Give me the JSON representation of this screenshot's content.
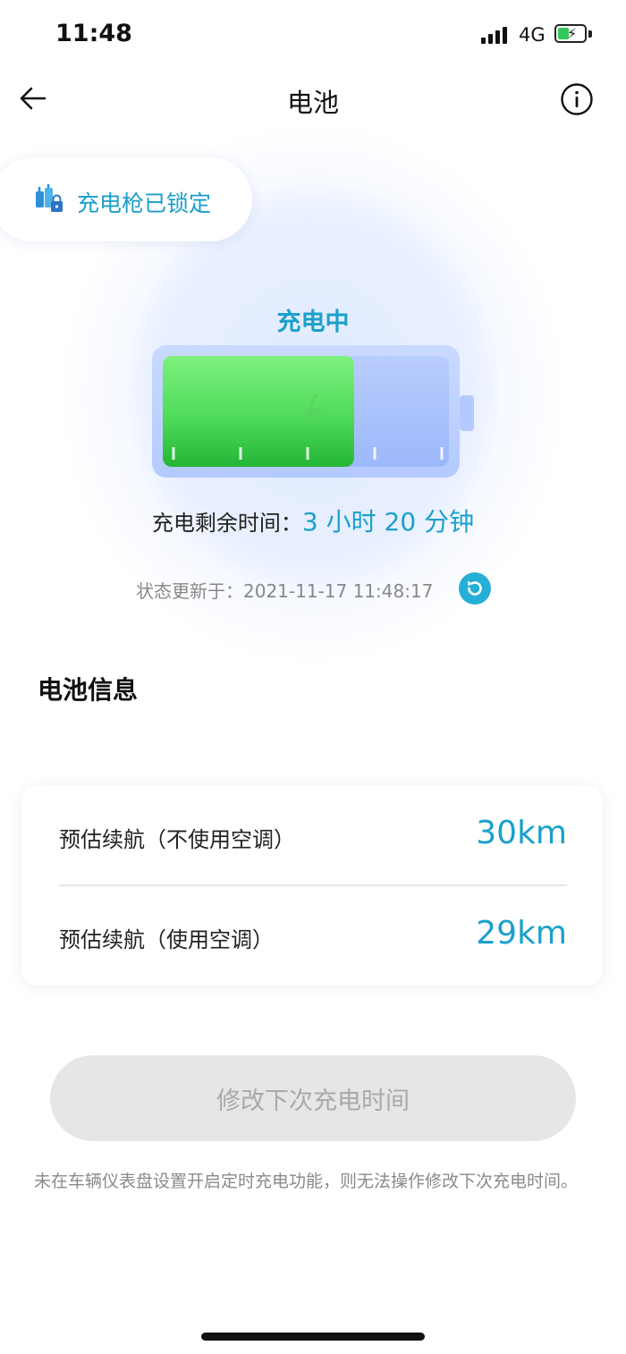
{
  "status_bar": {
    "time": "11:48",
    "network": "4G"
  },
  "nav": {
    "title": "电池",
    "back_icon": "arrow-left-icon",
    "info_icon": "info-icon"
  },
  "lock_status": {
    "text": "充电枪已锁定",
    "icon": "charger-lock-icon"
  },
  "charging": {
    "state_label": "充电中",
    "battery_level": 0.67,
    "remaining_label": "充电剩余时间：",
    "remaining_value": "3 小时 20 分钟",
    "updated_text": "状态更新于：2021-11-17 11:48:17"
  },
  "battery_info": {
    "section_title": "电池信息",
    "rows": [
      {
        "label": "预估续航（不使用空调）",
        "value": "30km"
      },
      {
        "label": "预估续航（使用空调）",
        "value": "29km"
      }
    ]
  },
  "action": {
    "button_label": "修改下次充电时间",
    "note": "未在车辆仪表盘设置开启定时充电功能，则无法操作修改下次充电时间。"
  },
  "colors": {
    "accent": "#1aa0cb",
    "battery_green": "#3cd04a",
    "battery_blue": "#a9c3ff"
  }
}
